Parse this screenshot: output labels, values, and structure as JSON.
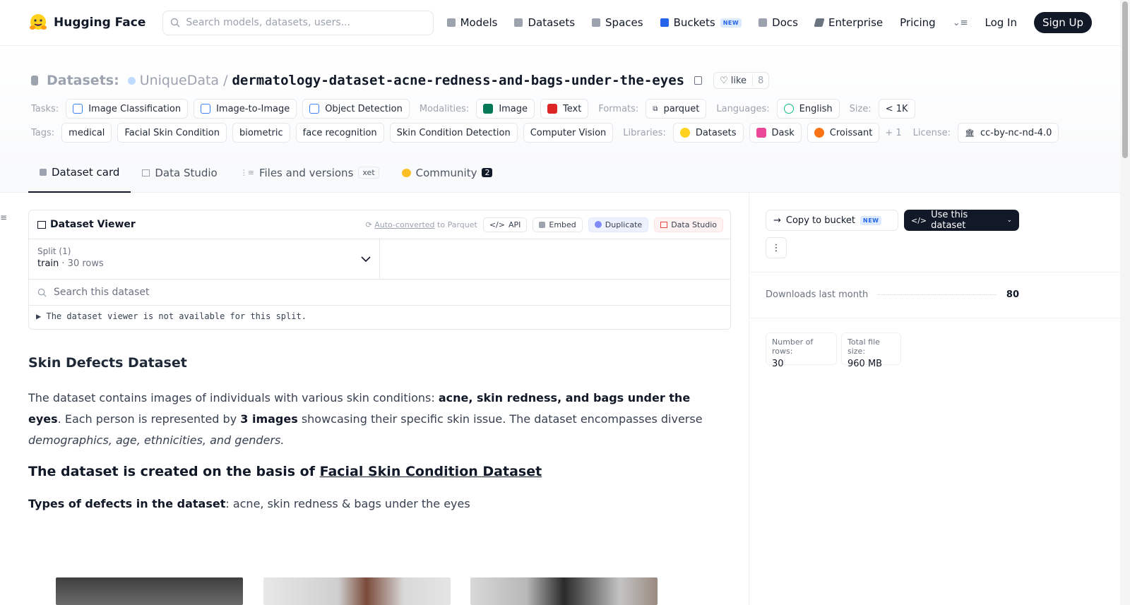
{
  "nav": {
    "brand": "Hugging Face",
    "search_placeholder": "Search models, datasets, users...",
    "links": [
      {
        "label": "Models",
        "icon": "cube-icon",
        "color": "#9ca3af"
      },
      {
        "label": "Datasets",
        "icon": "database-icon",
        "color": "#9ca3af"
      },
      {
        "label": "Spaces",
        "icon": "grid-icon",
        "color": "#9ca3af"
      },
      {
        "label": "Buckets",
        "icon": "bucket-icon",
        "color": "#2563eb",
        "badge": "NEW"
      },
      {
        "label": "Docs",
        "icon": "book-icon",
        "color": "#9ca3af"
      },
      {
        "label": "Enterprise",
        "icon": "enterprise-icon",
        "color": "#6b7280"
      }
    ],
    "pricing": "Pricing",
    "login": "Log In",
    "signup": "Sign Up"
  },
  "header": {
    "prefix": "Datasets:",
    "org": "UniqueData",
    "slash": "/",
    "name": "dermatology-dataset-acne-redness-and-bags-under-the-eyes",
    "like_label": "like",
    "like_count": "8"
  },
  "tags_row1": {
    "tasks_label": "Tasks:",
    "tasks": [
      "Image Classification",
      "Image-to-Image",
      "Object Detection"
    ],
    "modalities_label": "Modalities:",
    "modalities": [
      "Image",
      "Text"
    ],
    "formats_label": "Formats:",
    "formats": [
      "parquet"
    ],
    "languages_label": "Languages:",
    "languages": [
      "English"
    ],
    "size_label": "Size:",
    "size": "< 1K"
  },
  "tags_row2": {
    "tags_label": "Tags:",
    "tags": [
      "medical",
      "Facial Skin Condition",
      "biometric",
      "face recognition",
      "Skin Condition Detection",
      "Computer Vision"
    ],
    "libraries_label": "Libraries:",
    "libraries": [
      "Datasets",
      "Dask",
      "Croissant"
    ],
    "more": "+ 1",
    "license_label": "License:",
    "license": "cc-by-nc-nd-4.0"
  },
  "tabs": [
    {
      "label": "Dataset card",
      "active": true
    },
    {
      "label": "Data Studio",
      "active": false
    },
    {
      "label": "Files and versions",
      "active": false,
      "badge": "xet"
    },
    {
      "label": "Community",
      "active": false,
      "count": "2"
    }
  ],
  "viewer": {
    "title": "Dataset Viewer",
    "auto_converted": "Auto-converted",
    "to_parquet": "to Parquet",
    "api": "API",
    "embed": "Embed",
    "duplicate": "Duplicate",
    "data_studio": "Data Studio",
    "split_label": "Split (1)",
    "split_name": "train",
    "split_rows": "30 rows",
    "search_placeholder": "Search this dataset",
    "note": "The dataset viewer is not available for this split."
  },
  "card": {
    "heading": "Skin Defects Dataset",
    "p1_a": "The dataset contains images of individuals with various skin conditions: ",
    "p1_b": "acne, skin redness, and bags under the eyes",
    "p1_c": ". Each person is represented by ",
    "p1_d": "3 images",
    "p1_e": " showcasing their specific skin issue. The dataset encompasses diverse ",
    "p1_f": "demographics, age, ethnicities, and genders.",
    "h3_a": "The dataset is created on the basis of ",
    "h3_link": "Facial Skin Condition Dataset",
    "types_label": "Types of defects in the dataset",
    "types_value": ": acne, skin redness & bags under the eyes"
  },
  "sidebar": {
    "copy_to_bucket": "Copy to bucket",
    "copy_badge": "NEW",
    "use_dataset": "Use this dataset",
    "downloads_label": "Downloads last month",
    "downloads_value": "80",
    "rows_label": "Number of rows:",
    "rows_value": "30",
    "size_label": "Total file size:",
    "size_value": "960 MB"
  }
}
